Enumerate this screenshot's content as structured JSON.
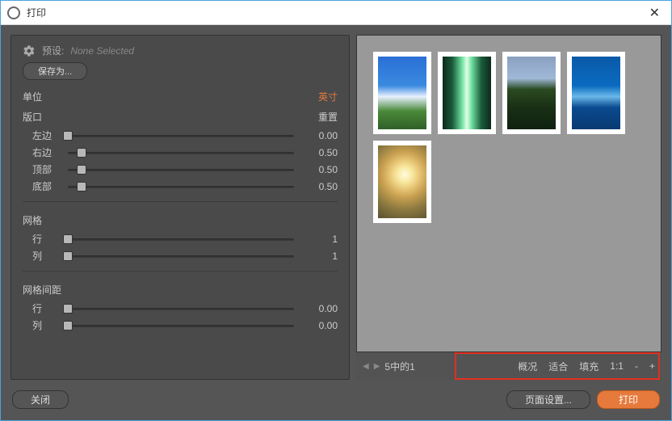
{
  "window": {
    "title": "打印"
  },
  "preset": {
    "label": "预设:",
    "value": "None Selected",
    "save_as": "保存为..."
  },
  "units": {
    "label": "单位",
    "value_link": "英寸"
  },
  "aperture": {
    "label": "版口",
    "reset": "重置",
    "sliders": [
      {
        "label": "左边",
        "value": "0.00",
        "pos": 0
      },
      {
        "label": "右边",
        "value": "0.50",
        "pos": 6
      },
      {
        "label": "顶部",
        "value": "0.50",
        "pos": 6
      },
      {
        "label": "底部",
        "value": "0.50",
        "pos": 6
      }
    ]
  },
  "grid": {
    "label": "网格",
    "sliders": [
      {
        "label": "行",
        "value": "1",
        "pos": 0
      },
      {
        "label": "列",
        "value": "1",
        "pos": 0
      }
    ]
  },
  "spacing": {
    "label": "网格间距",
    "sliders": [
      {
        "label": "行",
        "value": "0.00",
        "pos": 0
      },
      {
        "label": "列",
        "value": "0.00",
        "pos": 0
      }
    ]
  },
  "pager": {
    "text": "5中的1"
  },
  "zoom": {
    "overview": "概况",
    "fit": "适合",
    "fill": "填充",
    "ratio": "1:1",
    "minus": "-",
    "plus": "+"
  },
  "footer": {
    "close": "关闭",
    "page_setup": "页面设置...",
    "print": "打印"
  }
}
